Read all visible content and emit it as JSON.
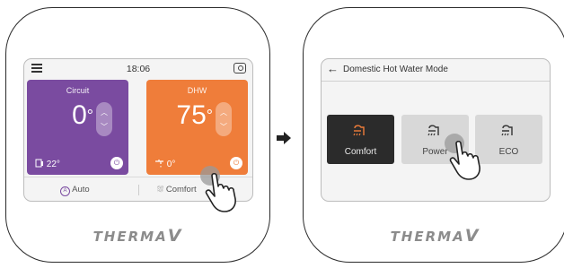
{
  "brand": "THERMA",
  "brand_v": "V",
  "left_screen": {
    "time": "18:06",
    "circuit": {
      "label": "Circuit",
      "temp": "0",
      "unit": "°",
      "current": "22°"
    },
    "dhw": {
      "label": "DHW",
      "temp": "75",
      "unit": "°",
      "current": "0°"
    },
    "bottom": {
      "auto": "Auto",
      "comfort": "Comfort"
    }
  },
  "right_screen": {
    "title": "Domestic Hot Water Mode",
    "modes": [
      {
        "label": "Comfort",
        "selected": true
      },
      {
        "label": "Power",
        "selected": false
      },
      {
        "label": "ECO",
        "selected": false
      }
    ]
  },
  "colors": {
    "circuit": "#7a4ba0",
    "dhw": "#ef7d3a",
    "selected_mode": "#2b2b2b",
    "selected_icon": "#ef7d3a"
  },
  "icons": [
    "menu-icon",
    "search-icon",
    "power-icon",
    "chevron-up-icon",
    "chevron-down-icon",
    "back-arrow-icon",
    "shower-icon",
    "hand-pointer-icon",
    "arrow-right-icon"
  ]
}
